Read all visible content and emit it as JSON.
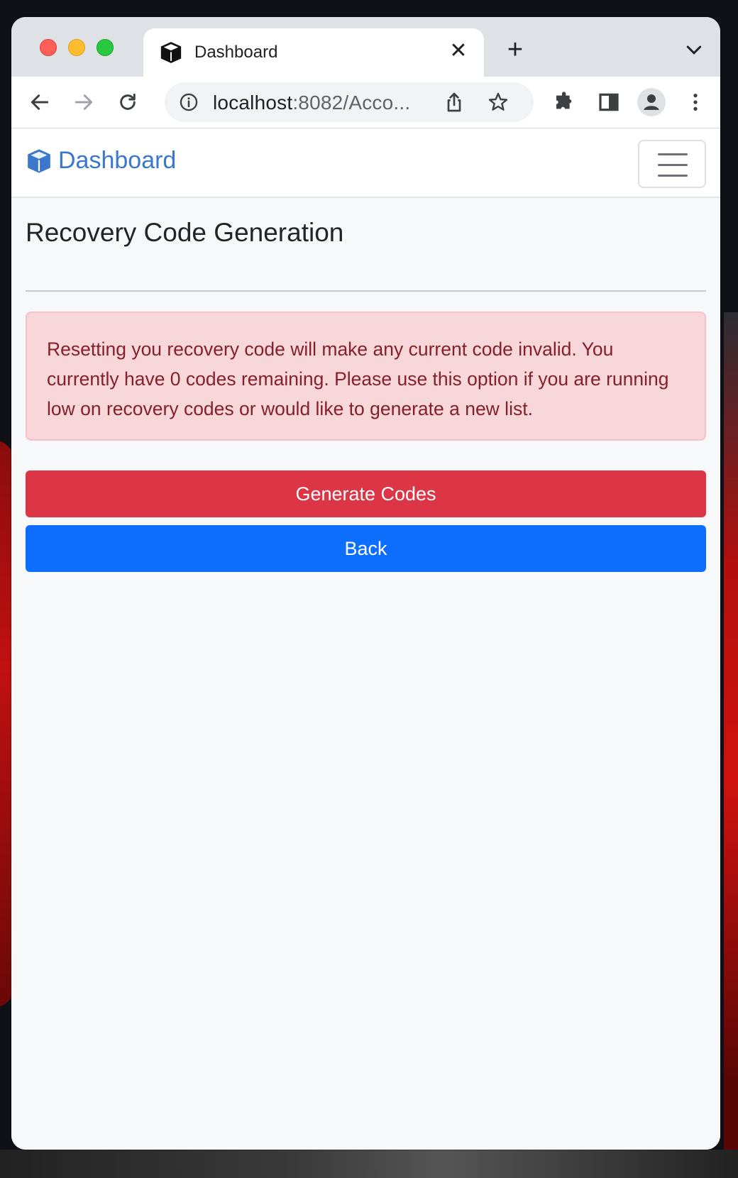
{
  "browser": {
    "tab": {
      "title": "Dashboard"
    },
    "address_bar": {
      "host": "localhost",
      "rest": ":8082/Acco..."
    }
  },
  "navbar": {
    "brand_label": "Dashboard"
  },
  "main": {
    "heading": "Recovery Code Generation",
    "alert_text": "Resetting you recovery code will make any current code invalid. You currently have 0 codes remaining. Please use this option if you are running low on recovery codes or would like to generate a new list.",
    "generate_button_label": "Generate Codes",
    "back_button_label": "Back"
  },
  "colors": {
    "brand": "#3b77cc",
    "danger": "#dc3545",
    "primary": "#0d6efd",
    "alert_bg": "#f8d7da",
    "alert_text": "#842029"
  },
  "icons": [
    "cube-icon",
    "close-icon",
    "plus-icon",
    "chevron-down-icon",
    "back-arrow-icon",
    "forward-arrow-icon",
    "reload-icon",
    "info-icon",
    "share-icon",
    "star-icon",
    "extensions-icon",
    "side-panel-icon",
    "profile-icon",
    "menu-dots-icon",
    "hamburger-icon"
  ]
}
